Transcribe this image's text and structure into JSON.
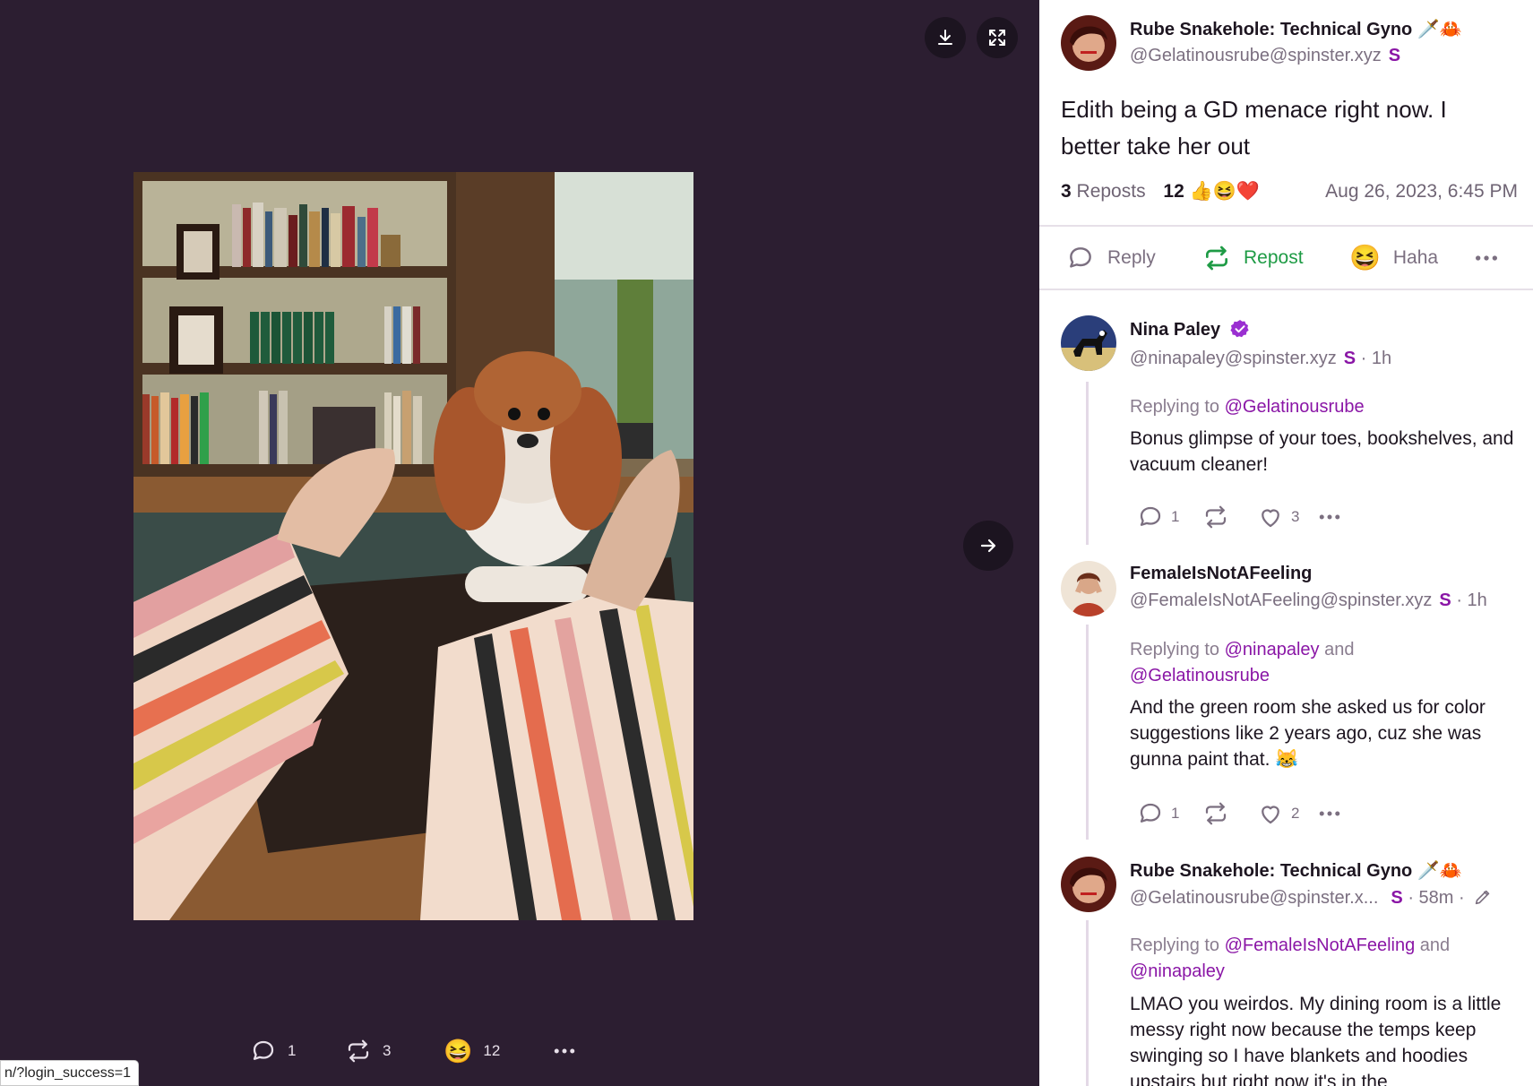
{
  "viewer": {
    "download_label": "download-icon",
    "fullscreen_label": "expand-icon",
    "next_label": "arrow-right-icon",
    "bottom": {
      "replies": "1",
      "reposts": "3",
      "reactions": "12"
    },
    "status_url": "n/?login_success=1"
  },
  "post": {
    "author_name": "Rube Snakehole: Technical Gyno 🗡️🦀",
    "author_handle": "@Gelatinousrube@spinster.xyz",
    "badge": "S",
    "text": "Edith being a GD menace right now. I better take her out",
    "reposts_count": "3",
    "reposts_label": "Reposts",
    "reactions_count": "12",
    "reaction_emojis": "👍😆❤️",
    "timestamp": "Aug 26, 2023, 6:45 PM"
  },
  "actions": {
    "reply": "Reply",
    "repost": "Repost",
    "haha": "Haha"
  },
  "replies": [
    {
      "name": "Nina Paley",
      "handle": "@ninapaley@spinster.xyz",
      "badge": "S",
      "meta": "· 1h",
      "replying_prefix": "Replying to",
      "replying_to": "@Gelatinousrube",
      "body": "Bonus glimpse of your toes, bookshelves, and vacuum cleaner!",
      "reply_count": "1",
      "like_count": "3"
    },
    {
      "name": "FemaleIsNotAFeeling",
      "handle": "@FemaleIsNotAFeeling@spinster.xyz",
      "badge": "S",
      "meta": "· 1h",
      "replying_prefix": "Replying to",
      "replying_to_1": "@ninapaley",
      "replying_and": "and",
      "replying_to_2": "@Gelatinousrube",
      "body": "And the green room she asked us for color suggestions like 2 years ago, cuz she was gunna paint that. 😹",
      "reply_count": "1",
      "like_count": "2"
    },
    {
      "name": "Rube Snakehole: Technical Gyno 🗡️🦀",
      "handle": "@Gelatinousrube@spinster.x...",
      "badge": "S",
      "meta": "· 58m ·",
      "replying_prefix": "Replying to",
      "replying_to_1": "@FemaleIsNotAFeeling",
      "replying_and": "and",
      "replying_to_2": "@ninapaley",
      "body": "LMAO you weirdos. My dining room is a little messy right now because the temps keep swinging so I have blankets and hoodies upstairs but right now it's in the"
    }
  ],
  "colors": {
    "viewer_bg": "#2c1e31",
    "accent": "#8a16a6",
    "repost_green": "#1e9b45"
  }
}
